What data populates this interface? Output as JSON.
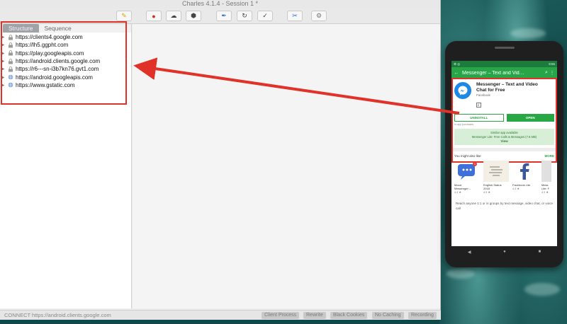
{
  "window": {
    "title": "Charles 4.1.4 - Session 1 *"
  },
  "toolbar": {
    "buttons": [
      {
        "name": "broom-icon",
        "glyph": "✎"
      },
      {
        "name": "record-icon",
        "glyph": "●"
      },
      {
        "name": "throttle-icon",
        "glyph": "☁"
      },
      {
        "name": "breakpoint-icon",
        "glyph": "⬢"
      },
      {
        "name": "compose-icon",
        "glyph": "✒"
      },
      {
        "name": "repeat-icon",
        "glyph": "↻"
      },
      {
        "name": "validate-icon",
        "glyph": "✓"
      },
      {
        "name": "tools-icon",
        "glyph": "✂"
      },
      {
        "name": "settings-icon",
        "glyph": "⚙"
      }
    ]
  },
  "tabs": {
    "structure": "Structure",
    "sequence": "Sequence"
  },
  "hosts": [
    "https://clients4.google.com",
    "https://lh5.ggpht.com",
    "https://play.googleapis.com",
    "https://android.clients.google.com",
    "https://r6---sn-i3b7kn76.gvt1.com",
    "https://android.googleapis.com",
    "https://www.gstatic.com"
  ],
  "status": {
    "text": "CONNECT https://android.clients.google.com",
    "buttons": [
      "Client Process",
      "Rewrite",
      "Black Cookies",
      "No Caching",
      "Recording"
    ]
  },
  "phone": {
    "statusbar_time": "9:55",
    "appbar_title": "Messenger – Text and Vid…",
    "app": {
      "name_line1": "Messenger – Text and Video",
      "name_line2": "Chat for Free",
      "developer": "Facebook",
      "rating_badge": "E"
    },
    "uninstall": "UNINSTALL",
    "open": "OPEN",
    "in_app": "In-app purchases",
    "lite": {
      "line1": "Similar app available",
      "line2": "Messenger Lite: Free Calls & Messages (7.6 MB)",
      "view": "View"
    },
    "also_title": "You might also like",
    "also_more": "MORE",
    "cards": [
      {
        "name": "Mood\nMessenger –",
        "rating": "4.4 ★",
        "badge": "1"
      },
      {
        "name": "English Status\n2018",
        "rating": "4.3 ★"
      },
      {
        "name": "Facebook Lite",
        "rating": "4.3 ★"
      },
      {
        "name": "Mess\nLite: F",
        "rating": "4.3 ★"
      }
    ],
    "description": "Reach anyone 1:1 or in groups by text message, video chat, or voice call"
  },
  "colors": {
    "highlight": "#e1322a",
    "play_green": "#27a548"
  }
}
